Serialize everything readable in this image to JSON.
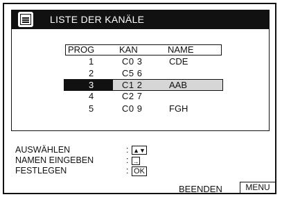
{
  "title": "LISTE DER KANÄLE",
  "columns": {
    "prog": "PROG",
    "kan": "KAN",
    "name": "NAME"
  },
  "rows": [
    {
      "prog": "1",
      "kan": "C0 3",
      "name": "CDE",
      "selected": false
    },
    {
      "prog": "2",
      "kan": "C5 6",
      "name": "",
      "selected": false
    },
    {
      "prog": "3",
      "kan": "C1 2",
      "name": "AAB",
      "selected": true
    },
    {
      "prog": "4",
      "kan": "C2 7",
      "name": "",
      "selected": false
    },
    {
      "prog": "5",
      "kan": "C0 9",
      "name": "FGH",
      "selected": false
    }
  ],
  "instructions": {
    "select": {
      "label": "AUSWÄHLEN",
      "key": "▲▼",
      "key_icon": "up-down-arrows-icon"
    },
    "enter_name": {
      "label": "NAMEN EINGEBEN",
      "key": "→",
      "key_icon": "right-arrow-icon"
    },
    "confirm": {
      "label": "FESTLEGEN",
      "key": "OK"
    }
  },
  "colon": ":",
  "footer": {
    "end_label": "BEENDEN",
    "menu_key": "MENU"
  }
}
